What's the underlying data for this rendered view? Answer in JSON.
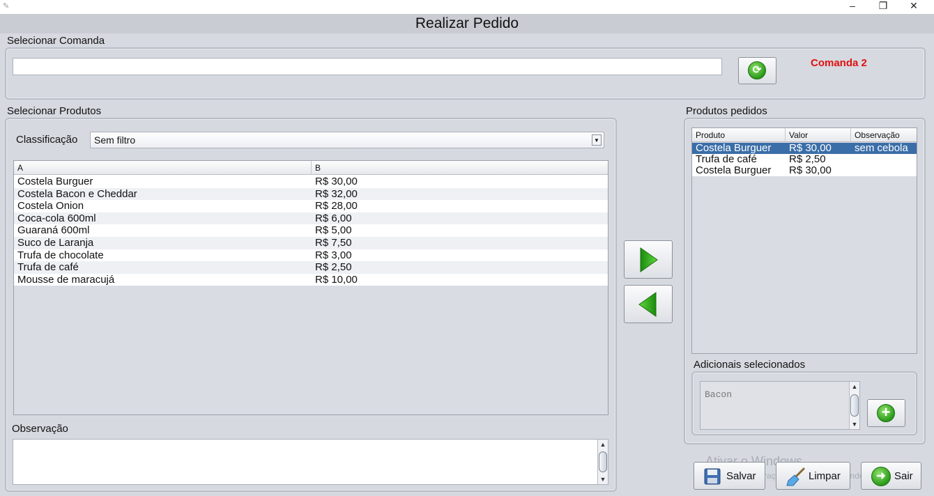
{
  "window": {
    "title": "Realizar Pedido",
    "minimize": "–",
    "restore": "❐",
    "close": "✕"
  },
  "comanda": {
    "group_label": "Selecionar Comanda",
    "input_value": "",
    "selected": "Comanda 2",
    "selected_color": "#e01010"
  },
  "produtos": {
    "group_label": "Selecionar Produtos",
    "filter_label": "Classificação",
    "filter_value": "Sem filtro",
    "columns": [
      "A",
      "B"
    ],
    "rows": [
      [
        "Costela Burguer",
        "R$ 30,00"
      ],
      [
        "Costela Bacon e Cheddar",
        "R$ 32,00"
      ],
      [
        "Costela Onion",
        "R$ 28,00"
      ],
      [
        "Coca-cola 600ml",
        "R$ 6,00"
      ],
      [
        "Guaraná 600ml",
        "R$ 5,00"
      ],
      [
        "Suco de Laranja",
        "R$ 7,50"
      ],
      [
        "Trufa de chocolate",
        "R$ 3,00"
      ],
      [
        "Trufa de café",
        "R$ 2,50"
      ],
      [
        "Mousse de maracujá",
        "R$ 10,00"
      ]
    ],
    "observacao_label": "Observação",
    "observacao_value": ""
  },
  "pedidos": {
    "group_label": "Produtos pedidos",
    "columns": [
      "Produto",
      "Valor",
      "Observação"
    ],
    "rows": [
      [
        "Costela Burguer",
        "R$ 30,00",
        "sem cebola"
      ],
      [
        "Trufa de café",
        "R$ 2,50",
        ""
      ],
      [
        "Costela Burguer",
        "R$ 30,00",
        ""
      ]
    ],
    "selected_row": 0,
    "selection_color": "#3a6ea8"
  },
  "adicionais": {
    "label": "Adicionais selecionados",
    "value": "Bacon"
  },
  "actions": {
    "salvar": "Salvar",
    "limpar": "Limpar",
    "sair": "Sair"
  },
  "watermark": {
    "line1": "Ativar o Windows",
    "line2": "Acesse Configurações para ativar o Windows."
  },
  "accent_green": "#2b9a1a"
}
